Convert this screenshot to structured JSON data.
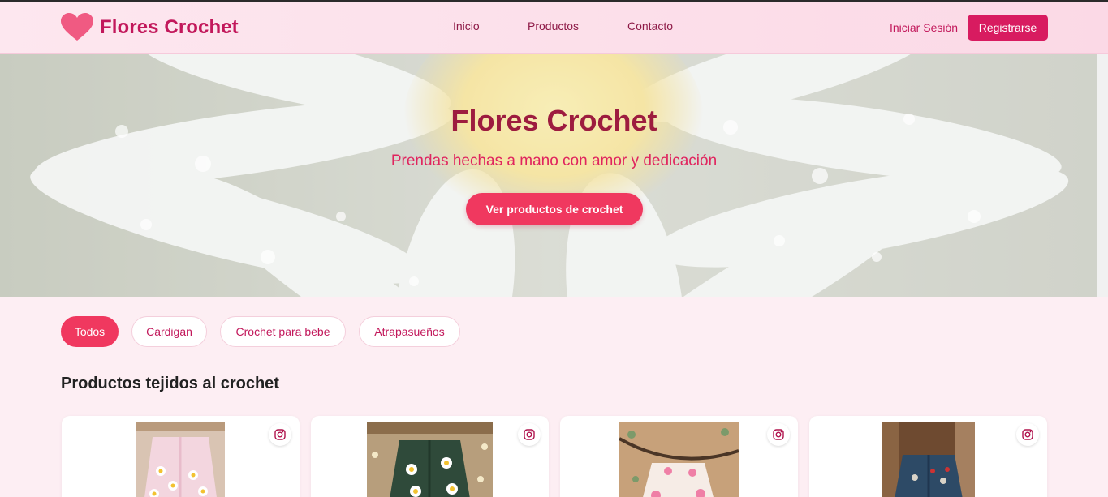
{
  "brand": {
    "name": "Flores Crochet",
    "accent": "#c2185b",
    "button": "#f0385f"
  },
  "nav": {
    "items": [
      {
        "label": "Inicio"
      },
      {
        "label": "Productos"
      },
      {
        "label": "Contacto"
      }
    ],
    "login_label": "Iniciar Sesión",
    "register_label": "Registrarse"
  },
  "hero": {
    "title": "Flores Crochet",
    "subtitle": "Prendas hechas a mano con amor y dedicación",
    "cta_label": "Ver productos de crochet"
  },
  "filters": [
    {
      "label": "Todos",
      "active": true
    },
    {
      "label": "Cardigan",
      "active": false
    },
    {
      "label": "Crochet para bebe",
      "active": false
    },
    {
      "label": "Atrapasueños",
      "active": false
    }
  ],
  "products_section": {
    "title": "Productos tejidos al crochet"
  },
  "products": [
    {
      "icon": "instagram-icon"
    },
    {
      "icon": "instagram-icon"
    },
    {
      "icon": "instagram-icon"
    },
    {
      "icon": "instagram-icon"
    }
  ]
}
